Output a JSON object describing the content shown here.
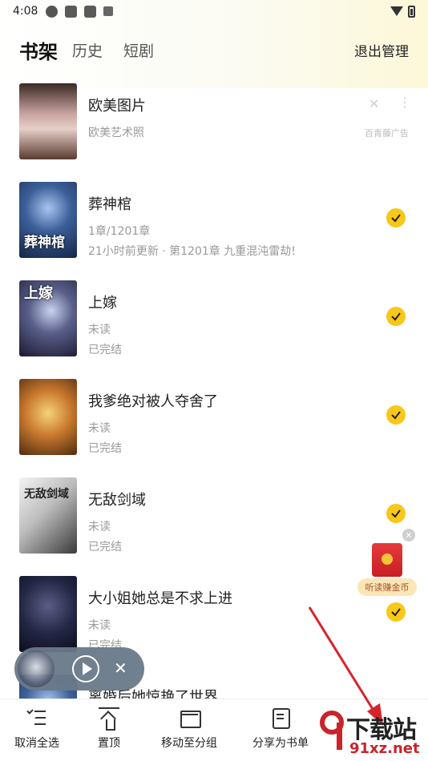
{
  "status_bar": {
    "time": "4:08"
  },
  "header": {
    "tabs": [
      {
        "label": "书架",
        "active": true
      },
      {
        "label": "历史",
        "active": false
      },
      {
        "label": "短剧",
        "active": false
      }
    ],
    "exit_manage": "退出管理"
  },
  "books": [
    {
      "title": "欧美图片",
      "sub1": "欧美艺术照",
      "sub2": "",
      "is_ad": true,
      "ad_source": "百青藤广告",
      "cover_text": ""
    },
    {
      "title": "葬神棺",
      "sub1": "1章/1201章",
      "sub2": "21小时前更新 · 第1201章 九重混沌雷劫!",
      "selected": true,
      "cover_text": "葬神棺"
    },
    {
      "title": "上嫁",
      "sub1": "未读",
      "sub2": "已完结",
      "selected": true,
      "cover_text": "上嫁"
    },
    {
      "title": "我爹绝对被人夺舍了",
      "sub1": "未读",
      "sub2": "已完结",
      "selected": true,
      "cover_text": ""
    },
    {
      "title": "无敌剑域",
      "sub1": "未读",
      "sub2": "已完结",
      "selected": true,
      "cover_text": "无敌剑域"
    },
    {
      "title": "大小姐她总是不求上进",
      "sub1": "未读",
      "sub2": "已完结",
      "selected": true,
      "cover_text": ""
    },
    {
      "title": "离婚后她惊艳了世界",
      "sub1": "",
      "sub2": "",
      "selected": true,
      "cover_text": ""
    }
  ],
  "reward_widget": {
    "label": "听读赚金币"
  },
  "bottom_bar": {
    "items": [
      {
        "label": "取消全选",
        "icon": "checklist-icon"
      },
      {
        "label": "置顶",
        "icon": "pin-top-icon"
      },
      {
        "label": "移动至分组",
        "icon": "folder-icon"
      },
      {
        "label": "分享为书单",
        "icon": "document-icon"
      }
    ]
  },
  "watermark": {
    "text": "下载站",
    "url": "91xz.net"
  },
  "colors": {
    "accent": "#f7c81a",
    "annotation_arrow": "#d8232a"
  }
}
